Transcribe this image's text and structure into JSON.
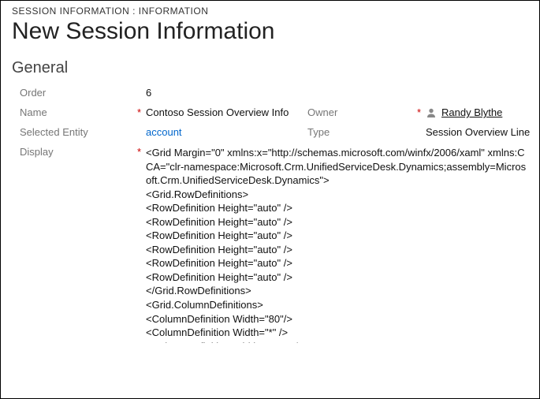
{
  "breadcrumb": "SESSION INFORMATION : INFORMATION",
  "title": "New Session Information",
  "section": "General",
  "fields": {
    "order_label": "Order",
    "order_value": "6",
    "name_label": "Name",
    "name_value": "Contoso Session Overview Info",
    "owner_label": "Owner",
    "owner_value": "Randy Blythe",
    "selected_entity_label": "Selected Entity",
    "selected_entity_value": "account",
    "type_label": "Type",
    "type_value": "Session Overview Line",
    "display_label": "Display",
    "display_value": "<Grid Margin=\"0\" xmlns:x=\"http://schemas.microsoft.com/winfx/2006/xaml\" xmlns:CCA=\"clr-namespace:Microsoft.Crm.UnifiedServiceDesk.Dynamics;assembly=Microsoft.Crm.UnifiedServiceDesk.Dynamics\">\n<Grid.RowDefinitions>\n<RowDefinition Height=\"auto\" />\n<RowDefinition Height=\"auto\" />\n<RowDefinition Height=\"auto\" />\n<RowDefinition Height=\"auto\" />\n<RowDefinition Height=\"auto\" />\n<RowDefinition Height=\"auto\" />\n</Grid.RowDefinitions>\n<Grid.ColumnDefinitions>\n<ColumnDefinition Width=\"80\"/>\n<ColumnDefinition Width=\"*\" />\n<ColumnDefinition Width=\"auto\" />"
  }
}
